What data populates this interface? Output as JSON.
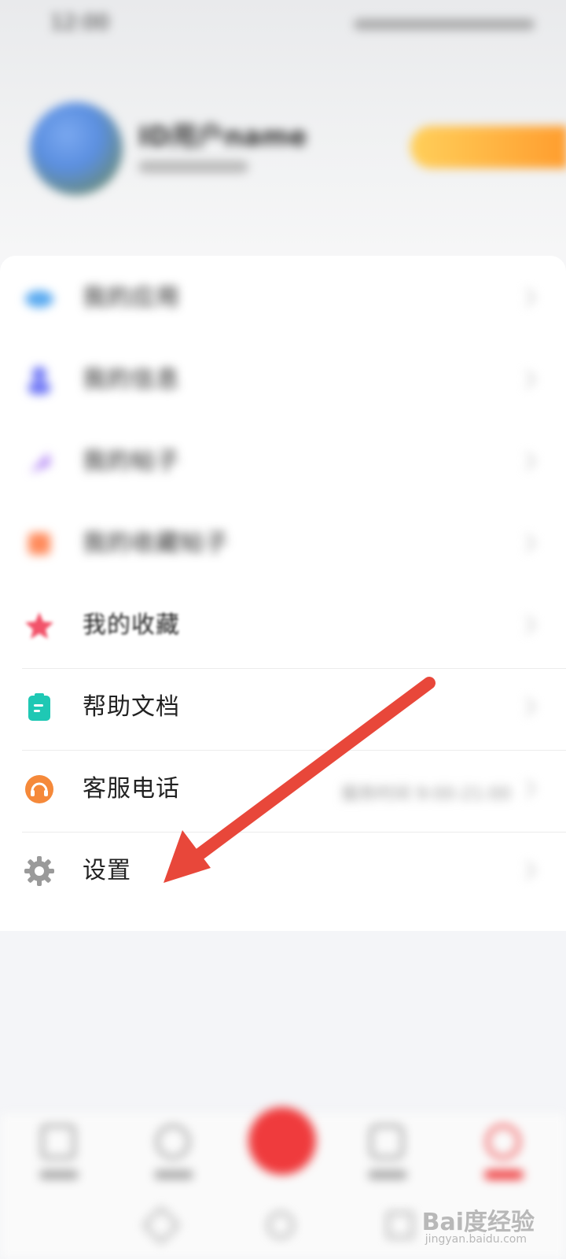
{
  "status_bar": {
    "time": "12:00"
  },
  "profile": {
    "username": "ID用户name"
  },
  "menu": {
    "items": [
      {
        "label": "我的应用",
        "icon": "cloud-icon",
        "color": "#5aaaf0"
      },
      {
        "label": "我的信息",
        "icon": "person-icon",
        "color": "#6a72f5"
      },
      {
        "label": "我的帖子",
        "icon": "feather-icon",
        "color": "#b58af5"
      },
      {
        "label": "我的收藏帖子",
        "icon": "bookmark-icon",
        "color": "#ff8a5b"
      },
      {
        "label": "我的收藏",
        "icon": "star-icon",
        "color": "#f2536a"
      },
      {
        "label": "帮助文档",
        "icon": "document-icon",
        "color": "#1fc8b4"
      },
      {
        "label": "客服电话",
        "icon": "headset-icon",
        "color": "#f5893a",
        "right_text": "服务时间 9:00-21:00"
      },
      {
        "label": "设置",
        "icon": "gear-icon",
        "color": "#9a9a9a"
      }
    ]
  },
  "watermark": {
    "brand": "Bai度经验",
    "url": "jingyan.baidu.com"
  },
  "annotation": {
    "arrow_color": "#e8473a"
  }
}
